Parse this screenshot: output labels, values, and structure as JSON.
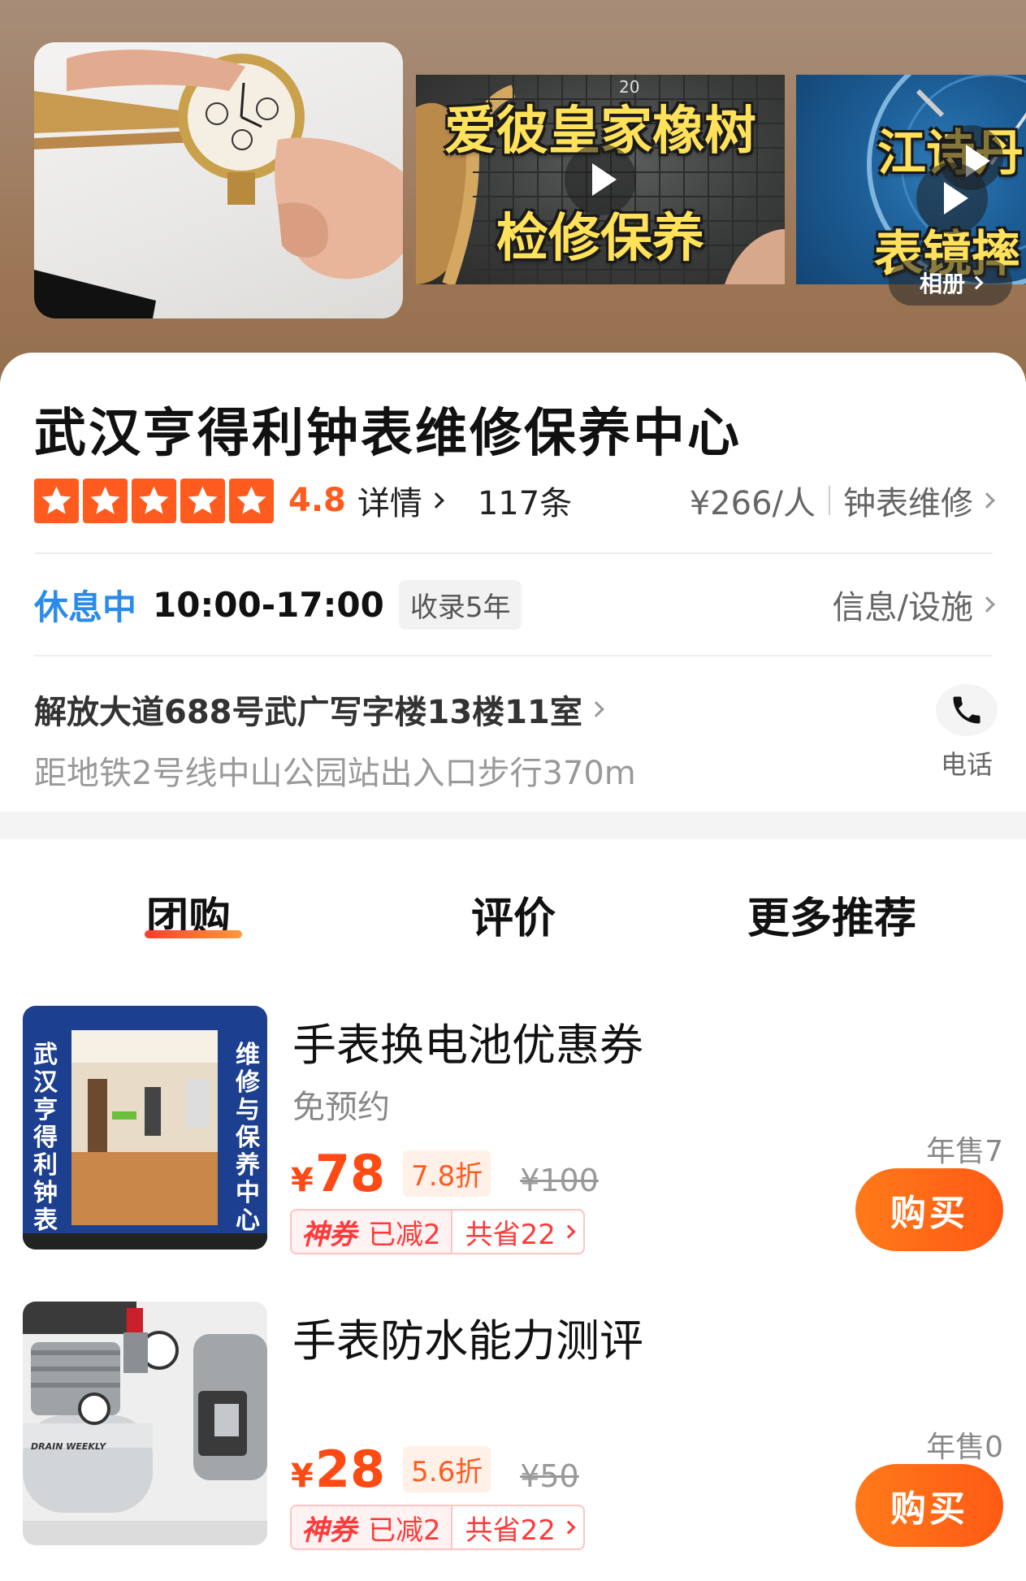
{
  "gallery": {
    "video1_caption_line1": "爱彼皇家橡树",
    "video1_caption_line2": "检修保养",
    "video2_caption_line1": "江诗丹",
    "video2_caption_line2": "表镜摔",
    "album_label": "相册"
  },
  "shop": {
    "name": "武汉亨得利钟表维修保养中心",
    "rating": "4.8",
    "detail_label": "详情",
    "review_count": "117条",
    "price_per_person": "¥266/人",
    "category": "钟表维修",
    "status": "休息中",
    "hours": "10:00-17:00",
    "years_tag": "收录5年",
    "info_link": "信息/设施",
    "address": "解放大道688号武广写字楼13楼11室",
    "metro": "距地铁2号线中山公园站出入口步行370m",
    "phone_label": "电话"
  },
  "tabs": [
    {
      "label": "团购",
      "active": true
    },
    {
      "label": "评价",
      "active": false
    },
    {
      "label": "更多推荐",
      "active": false
    }
  ],
  "deals": [
    {
      "title": "手表换电池优惠券",
      "subtitle": "免预约",
      "price_symbol": "¥",
      "price": "78",
      "discount": "7.8折",
      "original": "¥100",
      "coupon_label": "神券",
      "coupon_reduced": "已减2",
      "coupon_saved": "共省22",
      "sales": "年售7",
      "buy_label": "购买",
      "thumb_left_text": "武汉亨得利钟表",
      "thumb_right_text": "维修与保养中心"
    },
    {
      "title": "手表防水能力测评",
      "subtitle": "",
      "price_symbol": "¥",
      "price": "28",
      "discount": "5.6折",
      "original": "¥50",
      "coupon_label": "神券",
      "coupon_reduced": "已减2",
      "coupon_saved": "共省22",
      "sales": "年售0",
      "buy_label": "购买",
      "thumb_label": "DRAIN WEEKLY"
    }
  ],
  "colors": {
    "accent_orange": "#ff5b1f",
    "price_red": "#ff4a14",
    "status_blue": "#2b8be8"
  }
}
